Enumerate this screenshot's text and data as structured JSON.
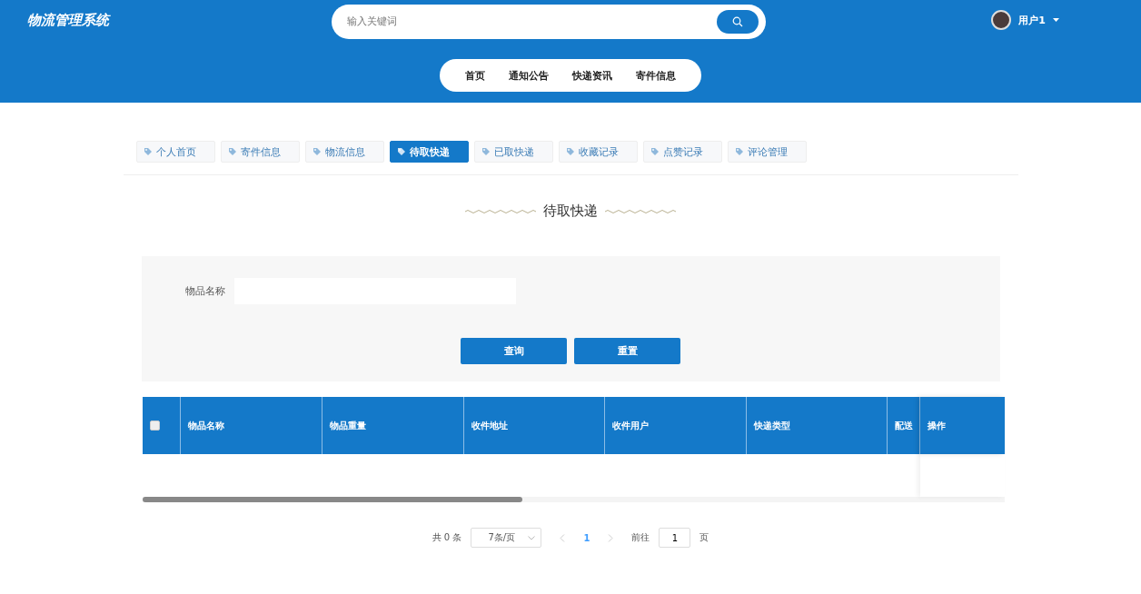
{
  "header": {
    "logo": "物流管理系统",
    "search": {
      "placeholder": "输入关键词"
    },
    "user": {
      "name": "用户1"
    }
  },
  "nav": [
    "首页",
    "通知公告",
    "快递资讯",
    "寄件信息"
  ],
  "tabs": [
    {
      "label": "个人首页",
      "selected": false
    },
    {
      "label": "寄件信息",
      "selected": false
    },
    {
      "label": "物流信息",
      "selected": false
    },
    {
      "label": "待取快递",
      "selected": true
    },
    {
      "label": "已取快递",
      "selected": false
    },
    {
      "label": "收藏记录",
      "selected": false
    },
    {
      "label": "点赞记录",
      "selected": false
    },
    {
      "label": "评论管理",
      "selected": false
    }
  ],
  "page_title": "待取快递",
  "filter": {
    "label": "物品名称",
    "buttons": [
      "查询",
      "重置"
    ]
  },
  "table": {
    "select_all": {
      "checked": false
    },
    "columns": [
      "物品名称",
      "物品重量",
      "收件地址",
      "收件用户",
      "快递类型",
      "配送"
    ],
    "fixed_column": "操作"
  },
  "pagination": {
    "total": "共 0 条",
    "page_size": "7条/页",
    "pages": [
      {
        "label": "1",
        "selected": true
      }
    ],
    "prev_disabled": true,
    "next_disabled": true,
    "jump_label": "前往",
    "jump_value": "1",
    "jump_suffix": "页"
  }
}
